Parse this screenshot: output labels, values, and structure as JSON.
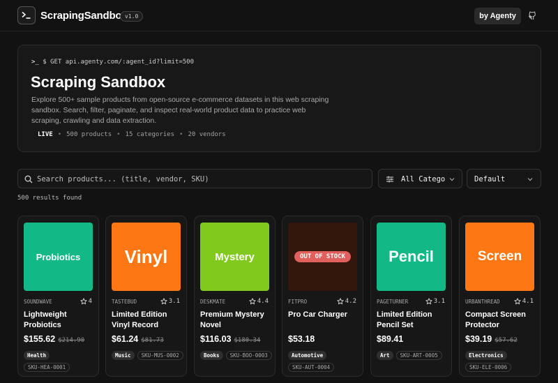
{
  "header": {
    "brand": "ScrapingSandbox",
    "version": "v1.0",
    "agenty_label": "by Agenty"
  },
  "hero": {
    "api_line": "$ GET api.agenty.com/:agent_id?limit=500",
    "title": "Scraping Sandbox",
    "description": "Explore 500+ sample products from open-source e-commerce datasets in this web scraping sandbox. Search, filter, paginate, and inspect real-world product data to practice web scraping, crawling and data extraction.",
    "stats": {
      "live": "LIVE",
      "products": "500 products",
      "categories": "15 categories",
      "vendors": "20 vendors"
    }
  },
  "filters": {
    "search_placeholder": "Search products... (title, vendor, SKU)",
    "category": "All Categories",
    "sort": "Default"
  },
  "results_text": "500 results found",
  "colors": {
    "green": "#12b886",
    "orange": "#fd7714",
    "lime": "#82c91e",
    "brown": "#5a2814",
    "oos": "#e0605e"
  },
  "products": [
    {
      "thumb_text": "Probiotics",
      "thumb_color": "#12b886",
      "vendor": "SOUNDWAVE",
      "rating": "4",
      "name": "Lightweight Probiotics",
      "price": "$155.62",
      "old_price": "$214.90",
      "category": "Health",
      "sku": "SKU-HEA-0001"
    },
    {
      "thumb_text": "Vinyl",
      "thumb_color": "#fd7714",
      "vendor": "TASTEBUD",
      "rating": "3.1",
      "name": "Limited Edition Vinyl Record",
      "price": "$61.24",
      "old_price": "$81.73",
      "category": "Music",
      "sku": "SKU-MUS-0002"
    },
    {
      "thumb_text": "Mystery",
      "thumb_color": "#82c91e",
      "vendor": "DESKMATE",
      "rating": "4.4",
      "name": "Premium Mystery Novel",
      "price": "$116.03",
      "old_price": "$180.34",
      "category": "Books",
      "sku": "SKU-BOO-0003"
    },
    {
      "thumb_text": "",
      "thumb_color": "#5a2814",
      "oos_label": "OUT OF STOCK",
      "vendor": "FITPRO",
      "rating": "4.2",
      "name": "Pro Car Charger",
      "price": "$53.18",
      "old_price": "",
      "category": "Automotive",
      "sku": "SKU-AUT-0004"
    },
    {
      "thumb_text": "Pencil",
      "thumb_color": "#12b886",
      "vendor": "PAGETURNER",
      "rating": "3.1",
      "name": "Limited Edition Pencil Set",
      "price": "$89.41",
      "old_price": "",
      "category": "Art",
      "sku": "SKU-ART-0005"
    },
    {
      "thumb_text": "Screen",
      "thumb_color": "#fd7714",
      "vendor": "URBANTHREAD",
      "rating": "4.1",
      "name": "Compact Screen Protector",
      "price": "$39.19",
      "old_price": "$57.62",
      "category": "Electronics",
      "sku": "SKU-ELE-0006"
    }
  ]
}
